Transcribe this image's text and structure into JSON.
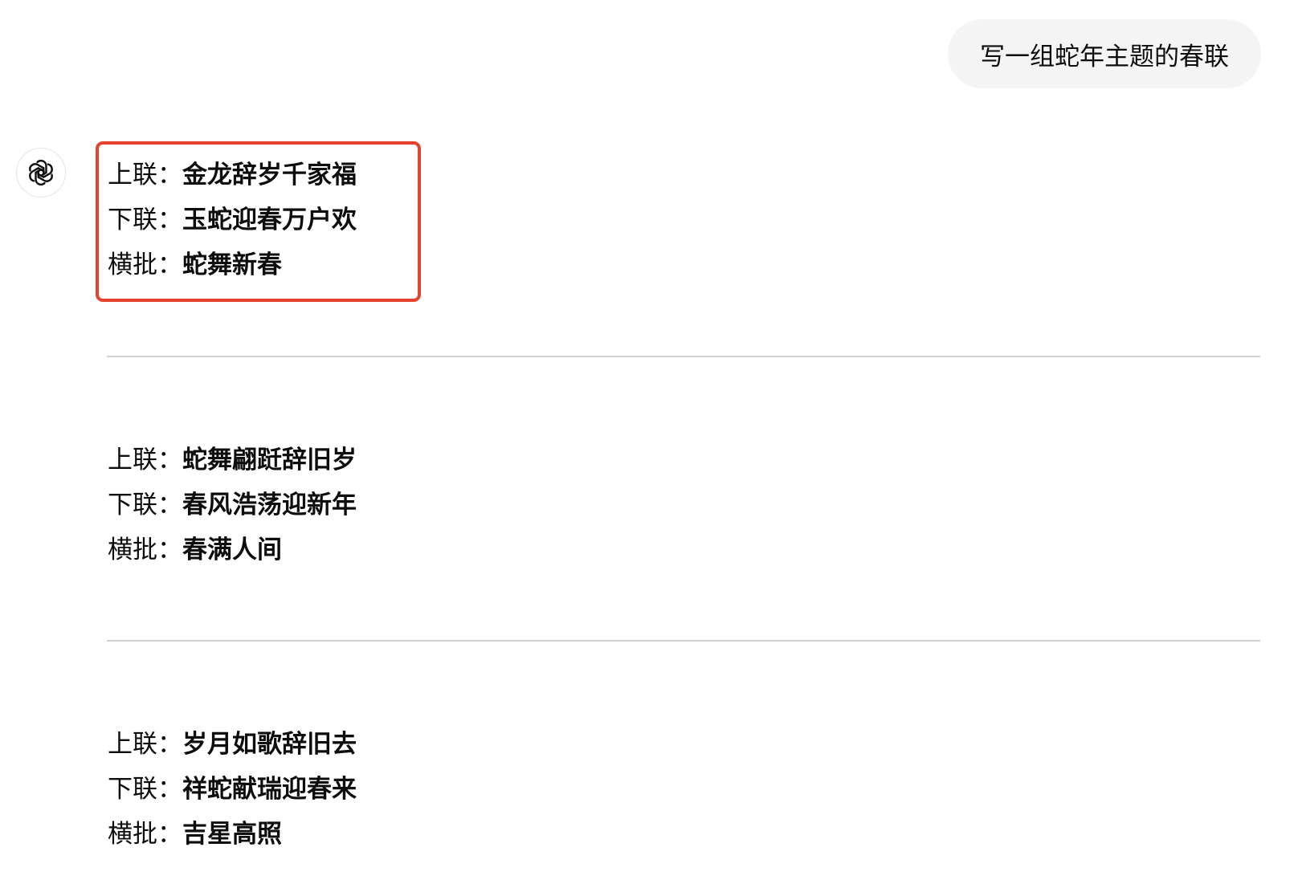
{
  "user_message": "写一组蛇年主题的春联",
  "assistant": {
    "avatar_icon": "openai-logo-icon",
    "highlight_color": "#e5432e",
    "couplets": [
      {
        "upper_label": "上联：",
        "upper": "金龙辞岁千家福",
        "lower_label": "下联：",
        "lower": "玉蛇迎春万户欢",
        "banner_label": "横批：",
        "banner": "蛇舞新春"
      },
      {
        "upper_label": "上联：",
        "upper": "蛇舞翩跹辞旧岁",
        "lower_label": "下联：",
        "lower": "春风浩荡迎新年",
        "banner_label": "横批：",
        "banner": "春满人间"
      },
      {
        "upper_label": "上联：",
        "upper": "岁月如歌辞旧去",
        "lower_label": "下联：",
        "lower": "祥蛇献瑞迎春来",
        "banner_label": "横批：",
        "banner": "吉星高照"
      }
    ]
  }
}
